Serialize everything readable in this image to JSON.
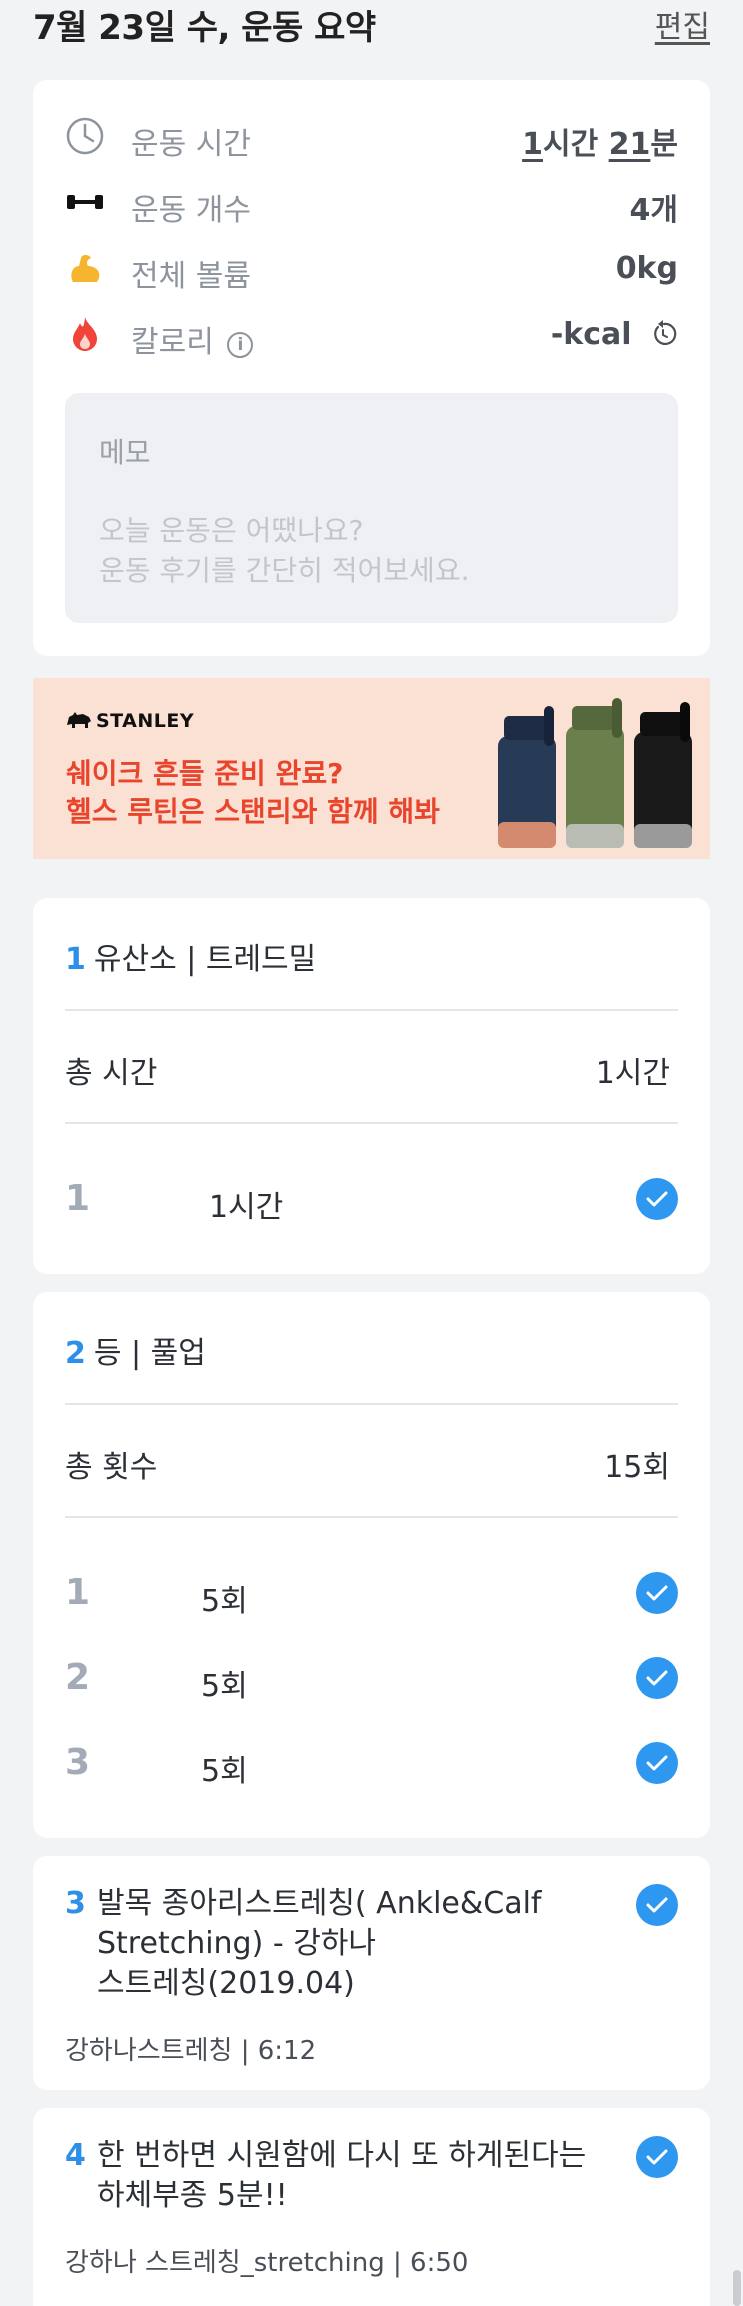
{
  "header": {
    "title": "7월 23일 수, 운동 요약",
    "edit_label": "편집"
  },
  "summary": {
    "duration_label": "운동 시간",
    "duration_hours": "1",
    "duration_hours_unit": "시간 ",
    "duration_minutes": "21",
    "duration_minutes_unit": "분",
    "count_label": "운동 개수",
    "count_value": "4개",
    "volume_label": "전체 볼륨",
    "volume_value": "0kg",
    "calorie_label": "칼로리",
    "calorie_value": "-kcal",
    "memo_title": "메모",
    "memo_placeholder": "오늘 운동은 어땠나요?\n운동 후기를 간단히 적어보세요."
  },
  "banner": {
    "brand": "STANLEY",
    "line1": "쉐이크 흔들 준비 완료?",
    "line2": "헬스 루틴은 스탠리와 함께 해봐",
    "colors": {
      "bg": "#fbe1d4",
      "text": "#e8452c"
    }
  },
  "exercises": [
    {
      "num": "1",
      "title": "유산소 | 트레드밀",
      "total_label": "총 시간",
      "total_value": "1시간",
      "sets": [
        {
          "num": "1",
          "value": "1시간",
          "done": true
        }
      ]
    },
    {
      "num": "2",
      "title": "등 | 풀업",
      "total_label": "총 횟수",
      "total_value": "15회",
      "sets": [
        {
          "num": "1",
          "value": "5회",
          "done": true
        },
        {
          "num": "2",
          "value": "5회",
          "done": true
        },
        {
          "num": "3",
          "value": "5회",
          "done": true
        }
      ]
    }
  ],
  "videos": [
    {
      "num": "3",
      "line1": "발목 종아리스트레칭( Ankle&Calf",
      "line2": "Stretching) - 강하나",
      "line3": "스트레칭(2019.04)",
      "meta": "강하나스트레칭 | 6:12",
      "done": true
    },
    {
      "num": "4",
      "line1": "한 번하면 시원함에 다시 또 하게된다는",
      "line2": "하체부종 5분!!",
      "meta": "강하나 스트레칭_stretching | 6:50",
      "done": true
    }
  ],
  "colors": {
    "accent": "#2e8fe8",
    "check": "#2e98f0",
    "background": "#f2f3f5"
  }
}
